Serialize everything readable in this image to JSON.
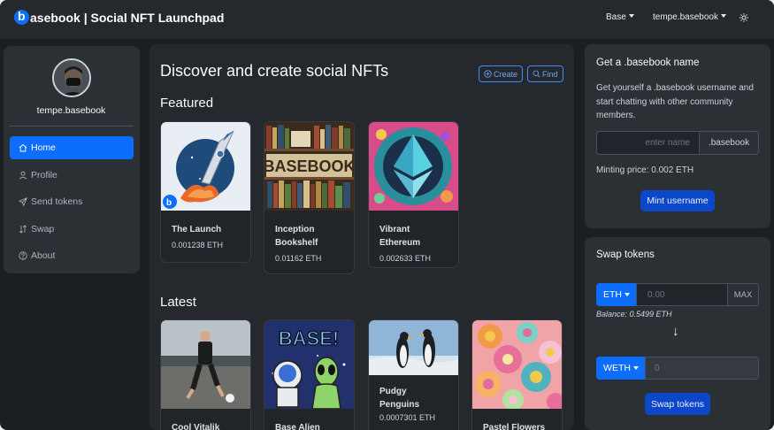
{
  "navbar": {
    "brand": "asebook | Social NFT Launchpad",
    "network": "Base",
    "account": "tempe.basebook"
  },
  "sidebar": {
    "username": "tempe.basebook",
    "items": [
      {
        "label": "Home",
        "icon": "home-icon"
      },
      {
        "label": "Profile",
        "icon": "person-icon"
      },
      {
        "label": "Send tokens",
        "icon": "send-icon"
      },
      {
        "label": "Swap",
        "icon": "swap-icon"
      },
      {
        "label": "About",
        "icon": "question-icon"
      }
    ]
  },
  "main": {
    "title": "Discover and create social NFTs",
    "create_label": "Create",
    "find_label": "Find",
    "featured_title": "Featured",
    "latest_title": "Latest",
    "featured": [
      {
        "name": "The Launch",
        "price": "0.001238 ETH"
      },
      {
        "name": "Inception Bookshelf",
        "price": "0.01162 ETH"
      },
      {
        "name": "Vibrant Ethereum",
        "price": "0.002633 ETH"
      }
    ],
    "latest": [
      {
        "name": "Cool Vitalik",
        "price": ""
      },
      {
        "name": "Base Alien",
        "price": ""
      },
      {
        "name": "Pudgy Penguins",
        "price": "0.0007301 ETH"
      },
      {
        "name": "Pastel Flowers",
        "price": ""
      }
    ],
    "image_text": {
      "bookshelf": "BASEBOOK",
      "alien": "BASE!"
    }
  },
  "name_card": {
    "title": "Get a .basebook name",
    "description": "Get yourself a .basebook username and start chatting with other community members.",
    "input_placeholder": "enter name",
    "suffix": ".basebook",
    "price_text": "Minting price: 0.002 ETH",
    "button": "Mint username"
  },
  "swap_card": {
    "title": "Swap tokens",
    "from_token": "ETH",
    "from_placeholder": "0.00",
    "max_label": "MAX",
    "balance": "Balance: 0.5499 ETH",
    "arrow": "↓",
    "to_token": "WETH",
    "to_value": "0",
    "button": "Swap tokens"
  },
  "colors": {
    "primary": "#0d6efd",
    "background": "#1b1f24",
    "card": "#2b3035"
  }
}
